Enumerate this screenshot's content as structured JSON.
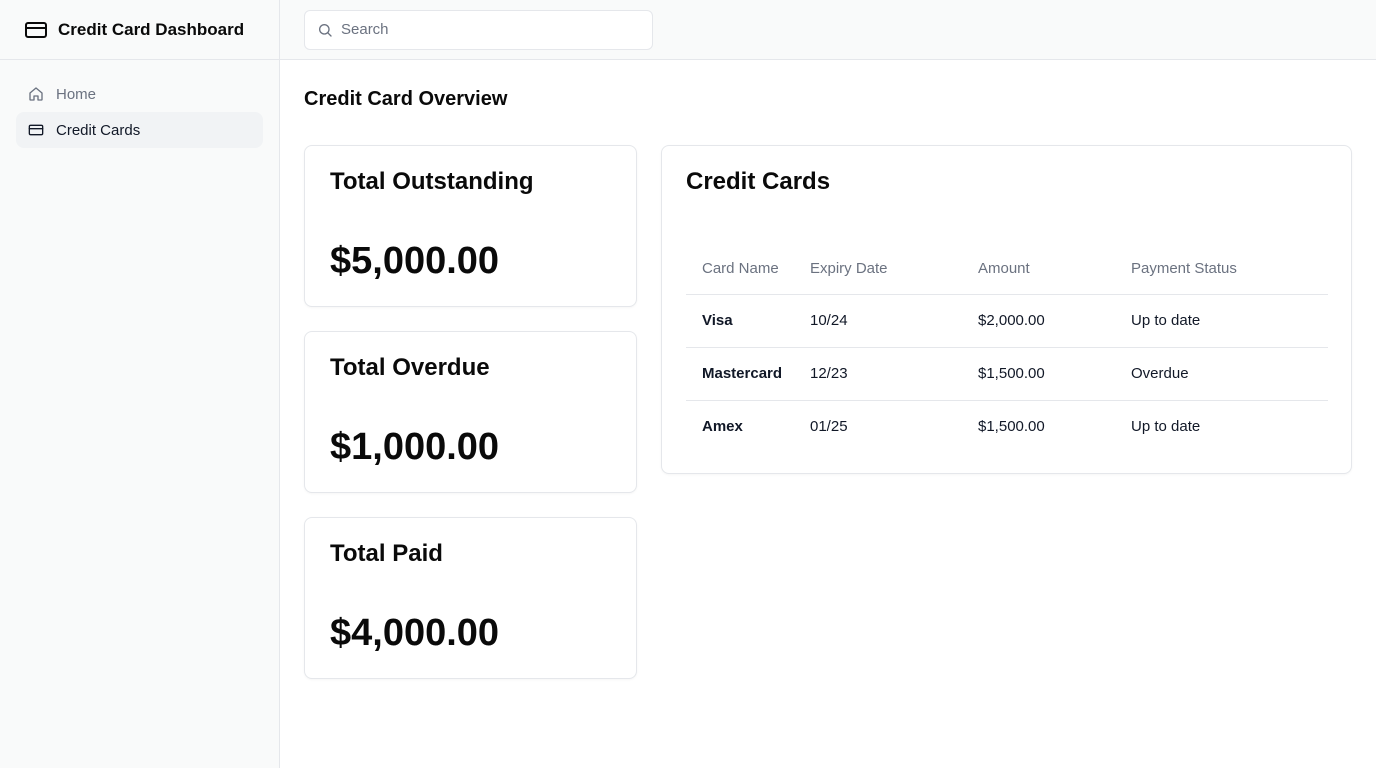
{
  "app": {
    "title": "Credit Card Dashboard",
    "logo_icon": "credit-card-icon"
  },
  "sidebar": {
    "items": [
      {
        "label": "Home",
        "icon": "home-icon",
        "active": false
      },
      {
        "label": "Credit Cards",
        "icon": "credit-card-icon",
        "active": true
      }
    ]
  },
  "search": {
    "placeholder": "Search",
    "value": "",
    "icon": "search-icon"
  },
  "main": {
    "page_title": "Credit Card Overview",
    "stats": [
      {
        "title": "Total Outstanding",
        "value": "$5,000.00"
      },
      {
        "title": "Total Overdue",
        "value": "$1,000.00"
      },
      {
        "title": "Total Paid",
        "value": "$4,000.00"
      }
    ],
    "table": {
      "title": "Credit Cards",
      "columns": [
        "Card Name",
        "Expiry Date",
        "Amount",
        "Payment Status"
      ],
      "rows": [
        [
          "Visa",
          "10/24",
          "$2,000.00",
          "Up to date"
        ],
        [
          "Mastercard",
          "12/23",
          "$1,500.00",
          "Overdue"
        ],
        [
          "Amex",
          "01/25",
          "$1,500.00",
          "Up to date"
        ]
      ]
    }
  },
  "colors": {
    "sidebar_bg": "#f9fafa",
    "border": "#e5e7eb",
    "active_bg": "#f1f3f5",
    "muted_text": "#6b7280",
    "text": "#0a0a0a"
  }
}
